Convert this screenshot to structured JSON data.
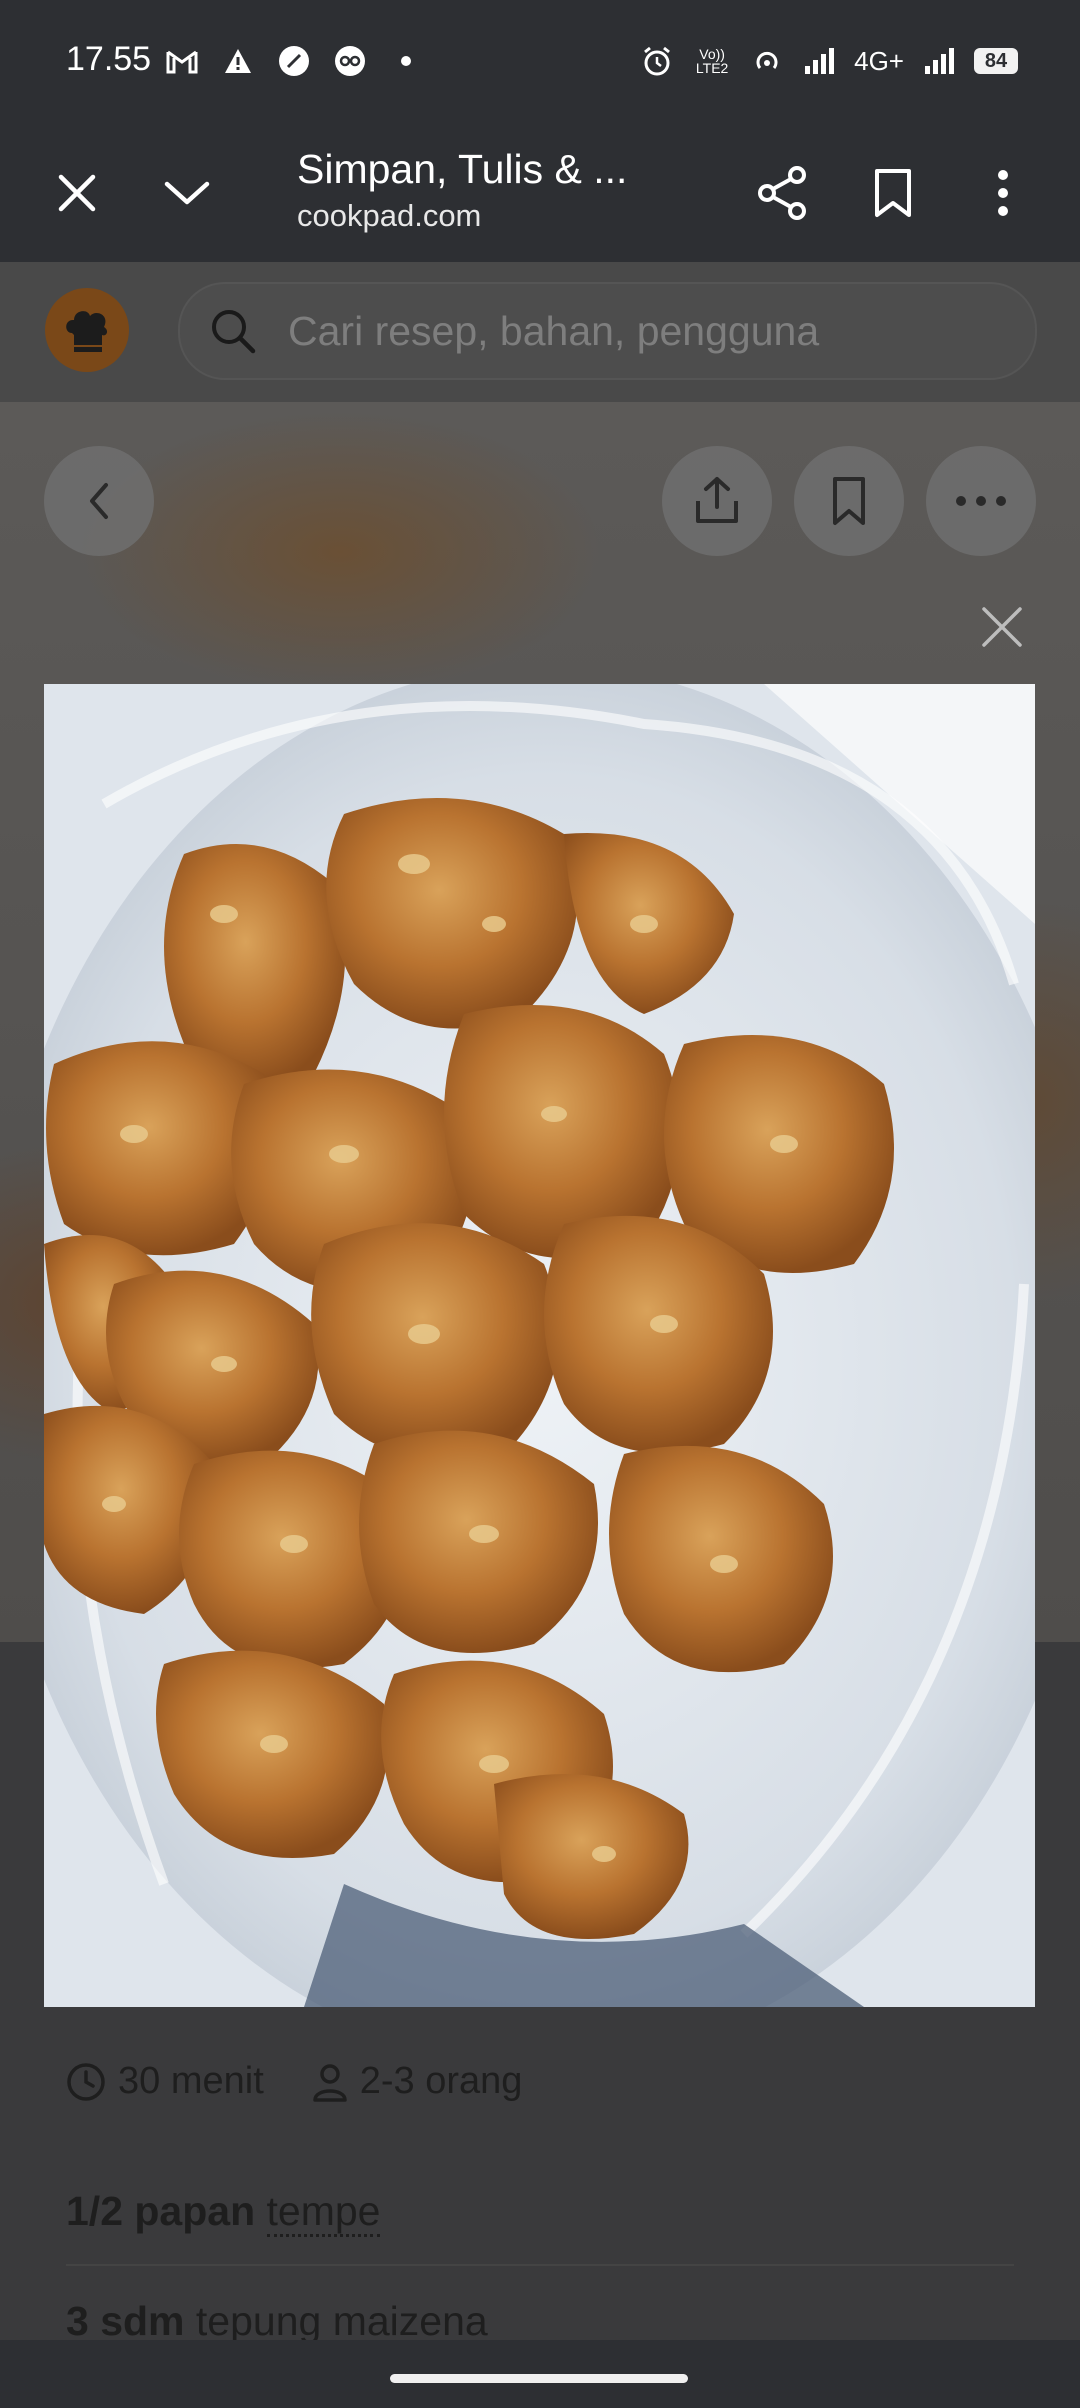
{
  "status": {
    "time": "17.55",
    "network": "4G+",
    "volte": "Vo)) LTE2",
    "battery": "84",
    "left_icons": [
      "gmail-icon",
      "warning-icon",
      "speed-icon",
      "app-icon",
      "dot-icon"
    ],
    "right_icons": [
      "alarm-icon",
      "volte-icon",
      "hotspot-icon",
      "signal-icon",
      "signal-icon",
      "battery-icon"
    ]
  },
  "browser": {
    "title": "Simpan, Tulis & ...",
    "url": "cookpad.com"
  },
  "app": {
    "search_placeholder": "Cari resep, bahan, pengguna"
  },
  "recipe": {
    "cook_time": "30 menit",
    "servings": "2-3 orang",
    "ingredients": [
      {
        "qty": "1/2 papan",
        "name": "tempe"
      },
      {
        "qty": "3 sdm",
        "name": "tepung maizena"
      }
    ]
  },
  "colors": {
    "status_bg": "#2d2f33",
    "appbar_bg": "#494949",
    "overlay_bg": "#3a3a3c",
    "brand_brown": "#7a4818"
  }
}
